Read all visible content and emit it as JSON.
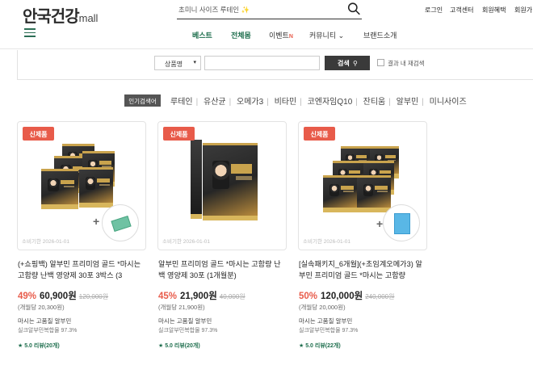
{
  "header": {
    "logo_main": "안국건강",
    "logo_sub": "mall",
    "search_placeholder": "초미니 사이즈 루테인 ✨",
    "util_links": [
      "로그인",
      "고객센터",
      "회원혜택",
      "회원가"
    ],
    "gnb": [
      "베스트",
      "전체몸",
      "이벤트",
      "N",
      "커뮤니티 ⌄",
      "브랜드소개"
    ]
  },
  "search_bar": {
    "select_value": "상품명",
    "button_label": "검색",
    "checkbox_label": "결과 내 재검색"
  },
  "popular": {
    "badge": "인기검색어",
    "keywords": [
      "루테인",
      "유산균",
      "오메가3",
      "비타민",
      "코엔자임Q10",
      "잔티움",
      "알부민",
      "미니사이즈"
    ]
  },
  "products": [
    {
      "badge": "신제품",
      "expiry": "소비기한 2026-01-01",
      "title": "(+쇼핑백) 알부민 프리미엄 골드 *마시는 고함량 난백 영양제 30포 3박스 (3",
      "discount": "49%",
      "price": "60,900원",
      "original": "120,000원",
      "unit": "(개월당 20,300원)",
      "desc1": "마시는 고품질 알부민",
      "desc2": "실크알부민복합물 97.3%",
      "review": "★ 5.0 리뷰(20개)"
    },
    {
      "badge": "신제품",
      "expiry": "소비기한 2026-01-01",
      "title": "알부민 프리미엄 골드 *마시는 고함량 난백 영양제 30포 (1개월분)",
      "discount": "45%",
      "price": "21,900원",
      "original": "40,000원",
      "unit": "(개월당 21,900원)",
      "desc1": "마시는 고품질 알부민",
      "desc2": "실크알부민복합물 97.3%",
      "review": "★ 5.0 리뷰(20개)"
    },
    {
      "badge": "신제품",
      "expiry": "소비기한 2026-01-01",
      "title": "[실속패키지_6개월](+초임계오메가3) 알부민 프리미엄 골드 *마시는 고함량",
      "discount": "50%",
      "price": "120,000원",
      "original": "240,000원",
      "unit": "(개월당 20,000원)",
      "desc1": "마시는 고품질 알부민",
      "desc2": "실크알부민복합물 97.3%",
      "review": "★ 5.0 리뷰(22개)"
    }
  ]
}
